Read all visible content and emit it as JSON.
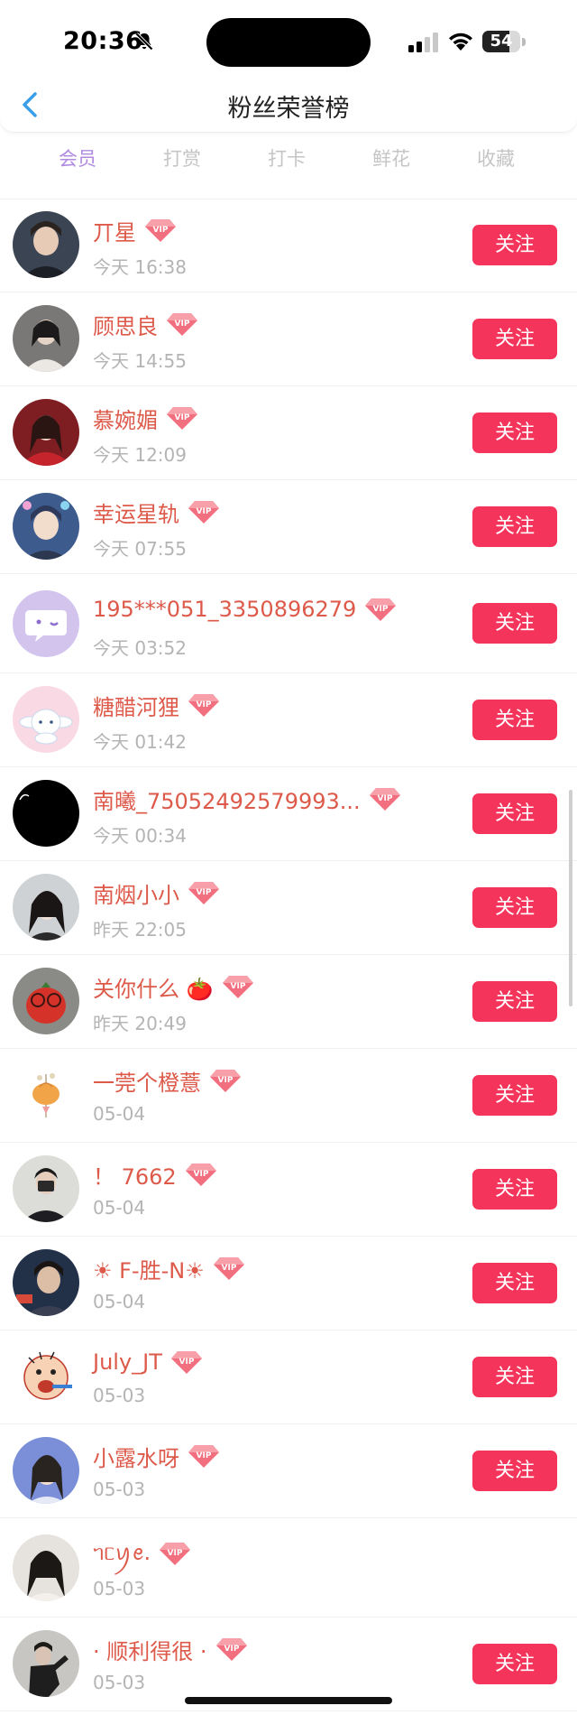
{
  "status_bar": {
    "time": "20:36",
    "battery": "54"
  },
  "nav": {
    "title": "粉丝荣誉榜"
  },
  "tabs": [
    {
      "label": "会员",
      "active": true
    },
    {
      "label": "打赏"
    },
    {
      "label": "打卡"
    },
    {
      "label": "鲜花"
    },
    {
      "label": "收藏"
    }
  ],
  "vip_badge_text": "VIP",
  "follow_label": "关注",
  "fans": [
    {
      "name": "丌星",
      "time": "今天 16:38"
    },
    {
      "name": "顾思良",
      "time": "今天 14:55"
    },
    {
      "name": "慕婉媚",
      "time": "今天 12:09"
    },
    {
      "name": "幸运星轨",
      "time": "今天 07:55"
    },
    {
      "name": "195***051_3350896279",
      "time": "今天 03:52"
    },
    {
      "name": "糖醋河狸",
      "time": "今天 01:42"
    },
    {
      "name": "南曦_75052492579993...",
      "time": "今天 00:34"
    },
    {
      "name": "南烟小小",
      "time": "昨天 22:05"
    },
    {
      "name": "关你什么 🍅",
      "time": "昨天 20:49"
    },
    {
      "name": "一莞个橙薏",
      "time": "05-04"
    },
    {
      "name": "！ 7662",
      "time": "05-04"
    },
    {
      "name": "☀ F-胜-N☀",
      "time": "05-04"
    },
    {
      "name": "July_JT",
      "time": "05-03"
    },
    {
      "name": "小露水呀",
      "time": "05-03"
    },
    {
      "name": "ᥐᥴꪗꫀ.",
      "time": "05-03"
    },
    {
      "name": "· 顺利得很 ·",
      "time": "05-03"
    }
  ],
  "colors": {
    "accent_tab": "#b08ae0",
    "follow_button": "#f5345b",
    "name_text": "#dd5a4a",
    "back_arrow": "#3a9ee8"
  }
}
